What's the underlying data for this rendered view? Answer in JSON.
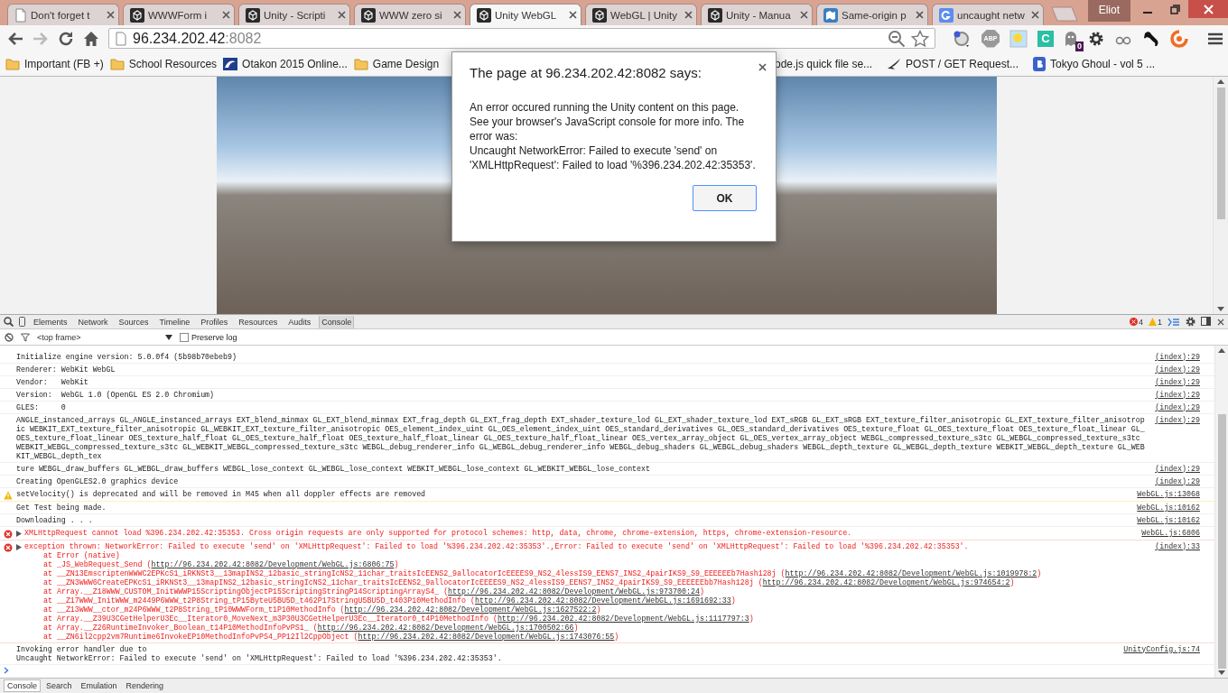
{
  "window": {
    "profile": "Eliot"
  },
  "tabs": [
    {
      "title": "Don't forget t",
      "kind": "document",
      "selected": false
    },
    {
      "title": "WWWForm i",
      "kind": "unity",
      "selected": false
    },
    {
      "title": "Unity - Scripti",
      "kind": "unity",
      "selected": false
    },
    {
      "title": "WWW zero si",
      "kind": "unity",
      "selected": false
    },
    {
      "title": "Unity WebGL",
      "kind": "unity",
      "selected": true
    },
    {
      "title": "WebGL | Unity",
      "kind": "unity",
      "selected": false
    },
    {
      "title": "Unity - Manua",
      "kind": "unity",
      "selected": false
    },
    {
      "title": "Same-origin p",
      "kind": "map",
      "selected": false
    },
    {
      "title": "uncaught netw",
      "kind": "tile",
      "selected": false
    }
  ],
  "toolbar": {
    "url_host": "96.234.202.42",
    "url_port": ":8082",
    "extensions": [
      {
        "kind": "globe"
      },
      {
        "kind": "octagon",
        "label": "ABP"
      },
      {
        "kind": "sun"
      },
      {
        "kind": "square",
        "label": "C"
      },
      {
        "kind": "ghost",
        "badge": "0"
      },
      {
        "kind": "gear"
      },
      {
        "kind": "glasses"
      },
      {
        "kind": "figure"
      },
      {
        "kind": "ring"
      }
    ]
  },
  "bookmarks": [
    {
      "label": "Important (FB +)",
      "kind": "folder"
    },
    {
      "label": "School Resources",
      "kind": "folder"
    },
    {
      "label": "Otakon 2015 Online...",
      "kind": "image"
    },
    {
      "label": "Game Design",
      "kind": "folder"
    },
    {
      "label": "ode.js quick file se..."
    },
    {
      "label": "POST / GET Request...",
      "kind": "bird"
    },
    {
      "label": "Tokyo Ghoul - vol 5 ...",
      "kind": "badge"
    }
  ],
  "dialog": {
    "title": "The page at 96.234.202.42:8082 says:",
    "message": "An error occured running the Unity content on this page. See your browser's JavaScript console for more info. The error was:\nUncaught NetworkError: Failed to execute 'send' on 'XMLHttpRequest': Failed to load '%396.234.202.42:35353'.",
    "ok_button": "OK"
  },
  "devtools": {
    "panels": [
      {
        "label": "Elements",
        "selected": false
      },
      {
        "label": "Network",
        "selected": false
      },
      {
        "label": "Sources",
        "selected": false
      },
      {
        "label": "Timeline",
        "selected": false
      },
      {
        "label": "Profiles",
        "selected": false
      },
      {
        "label": "Resources",
        "selected": false
      },
      {
        "label": "Audits",
        "selected": false
      },
      {
        "label": "Console",
        "selected": true
      }
    ],
    "error_count": "4",
    "warning_count": "1",
    "context": "<top frame>",
    "preserve_log": {
      "label": "Preserve log",
      "checked": false
    },
    "messages": [
      {
        "kind": "log",
        "text": "Initialize engine version: 5.0.0f4 (5b98b70ebeb9)",
        "source": "(index):29"
      },
      {
        "kind": "log",
        "text": "Renderer: WebKit WebGL",
        "source": "(index):29"
      },
      {
        "kind": "log",
        "text": "Vendor:   WebKit",
        "source": "(index):29"
      },
      {
        "kind": "log",
        "text": "Version:  WebGL 1.0 (OpenGL ES 2.0 Chromium)",
        "source": "(index):29"
      },
      {
        "kind": "log",
        "text": "GLES:     0",
        "source": "(index):29"
      },
      {
        "kind": "log",
        "text": "ANGLE_instanced_arrays GL_ANGLE_instanced_arrays EXT_blend_minmax GL_EXT_blend_minmax EXT_frag_depth GL_EXT_frag_depth EXT_shader_texture_lod GL_EXT_shader_texture_lod EXT_sRGB GL_EXT_sRGB EXT_texture_filter_anisotropic GL_EXT_texture_filter_anisotropic WEBKIT_EXT_texture_filter_anisotropic GL_WEBKIT_EXT_texture_filter_anisotropic OES_element_index_uint GL_OES_element_index_uint OES_standard_derivatives GL_OES_standard_derivatives OES_texture_float GL_OES_texture_float OES_texture_float_linear GL_OES_texture_float_linear OES_texture_half_float GL_OES_texture_half_float OES_texture_half_float_linear GL_OES_texture_half_float_linear OES_vertex_array_object GL_OES_vertex_array_object WEBGL_compressed_texture_s3tc GL_WEBGL_compressed_texture_s3tc WEBKIT_WEBGL_compressed_texture_s3tc GL_WEBKIT_WEBGL_compressed_texture_s3tc WEBGL_debug_renderer_info GL_WEBGL_debug_renderer_info WEBGL_debug_shaders GL_WEBGL_debug_shaders WEBGL_depth_texture GL_WEBGL_depth_texture WEBKIT_WEBGL_depth_texture GL_WEBKIT_WEBGL_depth_tex",
        "source": "(index):29"
      },
      {
        "kind": "log",
        "text": "ture WEBGL_draw_buffers GL_WEBGL_draw_buffers WEBGL_lose_context GL_WEBGL_lose_context WEBKIT_WEBGL_lose_context GL_WEBKIT_WEBGL_lose_context",
        "source": "(index):29"
      },
      {
        "kind": "log",
        "text": "Creating OpenGLES2.0 graphics device",
        "source": "(index):29"
      },
      {
        "kind": "warning",
        "text": "setVelocity() is deprecated and will be removed in M45 when all doppler effects are removed",
        "source": "WebGL.js:13068"
      },
      {
        "kind": "log",
        "text": "Get Test being made.",
        "source": "WebGL.js:10162"
      },
      {
        "kind": "log",
        "text": "Downloading . . .",
        "source": "WebGL.js:10162"
      },
      {
        "kind": "error",
        "expanded": false,
        "text": "XMLHttpRequest cannot load %396.234.202.42:35353. Cross origin requests are only supported for protocol schemes: http, data, chrome, chrome-extension, https, chrome-extension-resource.",
        "source": "WebGL.js:6806"
      },
      {
        "kind": "error",
        "expanded": false,
        "text": "exception thrown: NetworkError: Failed to execute 'send' on 'XMLHttpRequest': Failed to load '%396.234.202.42:35353'.,Error: Failed to execute 'send' on 'XMLHttpRequest': Failed to load '%396.234.202.42:35353'.",
        "source": "(index):33",
        "stack": [
          {
            "call": "at Error (native)"
          },
          {
            "call": "at _JS_WebRequest_Send (",
            "link": "http://96.234.202.42:8082/Development/WebGL.js:6806:75",
            "end": ")"
          },
          {
            "call": "at __ZN13EmscriptenWWWC2EPKcS1_iRKNSt3__13mapINS2_12basic_stringIcNS2_11char_traitsIcEENS2_9allocatorIcEEEES9_NS2_4lessIS9_EENS7_INS2_4pairIKS9_S9_EEEEEEb7Hash128j (",
            "link": "http://96.234.202.42:8082/Development/WebGL.js:1019978:2",
            "end": ")"
          },
          {
            "call": "at __ZN3WWW6CreateEPKcS1_iRKNSt3__13mapINS2_12basic_stringIcNS2_11char_traitsIcEENS2_9allocatorIcEEEES9_NS2_4lessIS9_EENS7_INS2_4pairIKS9_S9_EEEEEEbb7Hash128j (",
            "link": "http://96.234.202.42:8082/Development/WebGL.js:974654:2",
            "end": ")"
          },
          {
            "call": "at Array.__Z18WWW_CUSTOM_InitWWWP15ScriptingObjectP15ScriptingStringP14ScriptingArrayS4_ (",
            "link": "http://96.234.202.42:8082/Development/WebGL.js:973700:24",
            "end": ")"
          },
          {
            "call": "at __Z17WWW_InitWWW_m2449P6WWW_t2P8String_tP15ByteU5BU5D_t462P17StringU5BU5D_t403P10MethodInfo (",
            "link": "http://96.234.202.42:8082/Development/WebGL.js:1691692:33",
            "end": ")"
          },
          {
            "call": "at __Z13WWW__ctor_m24P6WWW_t2P8String_tP10WWWForm_t1P10MethodInfo (",
            "link": "http://96.234.202.42:8082/Development/WebGL.js:1627522:2",
            "end": ")"
          },
          {
            "call": "at Array.__Z39U3CGetHelperU3Ec__Iterator0_MoveNext_m3P30U3CGetHelperU3Ec__Iterator0_t4P10MethodInfo (",
            "link": "http://96.234.202.42:8082/Development/WebGL.js:1117797:3",
            "end": ")"
          },
          {
            "call": "at Array.__Z26RuntimeInvoker_Boolean_t14P10MethodInfoPvPS1_ (",
            "link": "http://96.234.202.42:8082/Development/WebGL.js:1700502:66",
            "end": ")"
          },
          {
            "call": "at __ZN6il2cpp2vm7Runtime6InvokeEP10MethodInfoPvPS4_PP12Il2CppObject (",
            "link": "http://96.234.202.42:8082/Development/WebGL.js:1743076:55",
            "end": ")"
          }
        ]
      },
      {
        "kind": "log",
        "text": "Invoking error handler due to\nUncaught NetworkError: Failed to execute 'send' on 'XMLHttpRequest': Failed to load '%396.234.202.42:35353'.",
        "source": "UnityConfig.js:74"
      }
    ],
    "drawer_tabs": [
      {
        "label": "Console",
        "selected": true
      },
      {
        "label": "Search",
        "selected": false
      },
      {
        "label": "Emulation",
        "selected": false
      },
      {
        "label": "Rendering",
        "selected": false
      }
    ]
  }
}
